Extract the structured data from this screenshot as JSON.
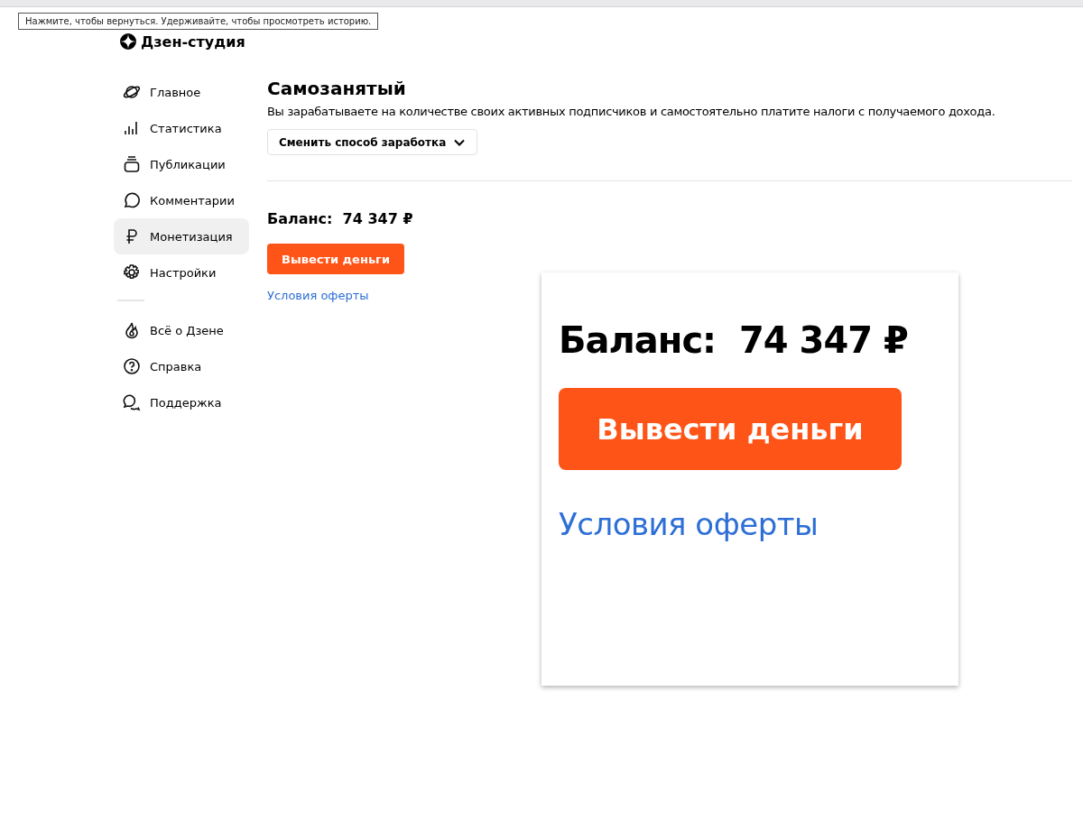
{
  "tooltip": {
    "text": "Нажмите, чтобы вернуться. Удерживайте, чтобы просмотреть историю."
  },
  "logo": {
    "text": "Дзен-студия"
  },
  "sidebar": {
    "items": [
      {
        "label": "Главное",
        "selected": false
      },
      {
        "label": "Статистика",
        "selected": false
      },
      {
        "label": "Публикации",
        "selected": false
      },
      {
        "label": "Комментарии",
        "selected": false
      },
      {
        "label": "Монетизация",
        "selected": true
      },
      {
        "label": "Настройки",
        "selected": false
      }
    ],
    "bottom_items": [
      {
        "label": "Всё о Дзене",
        "selected": false
      },
      {
        "label": "Справка",
        "selected": false
      },
      {
        "label": "Поддержка",
        "selected": false
      }
    ]
  },
  "main": {
    "title": "Самозанятый",
    "description": "Вы зарабатываете на количестве своих активных подписчиков и самостоятельно платите налоги с получаемого дохода.",
    "change_button": "Сменить способ заработка",
    "balance": "Баланс:  74 347 ₽",
    "withdraw_button": "Вывести деньги",
    "offer_link": "Условия оферты"
  },
  "zoom_inset": {
    "balance": "Баланс:  74 347 ₽",
    "withdraw_button": "Вывести деньги",
    "offer_link": "Условия оферты"
  }
}
